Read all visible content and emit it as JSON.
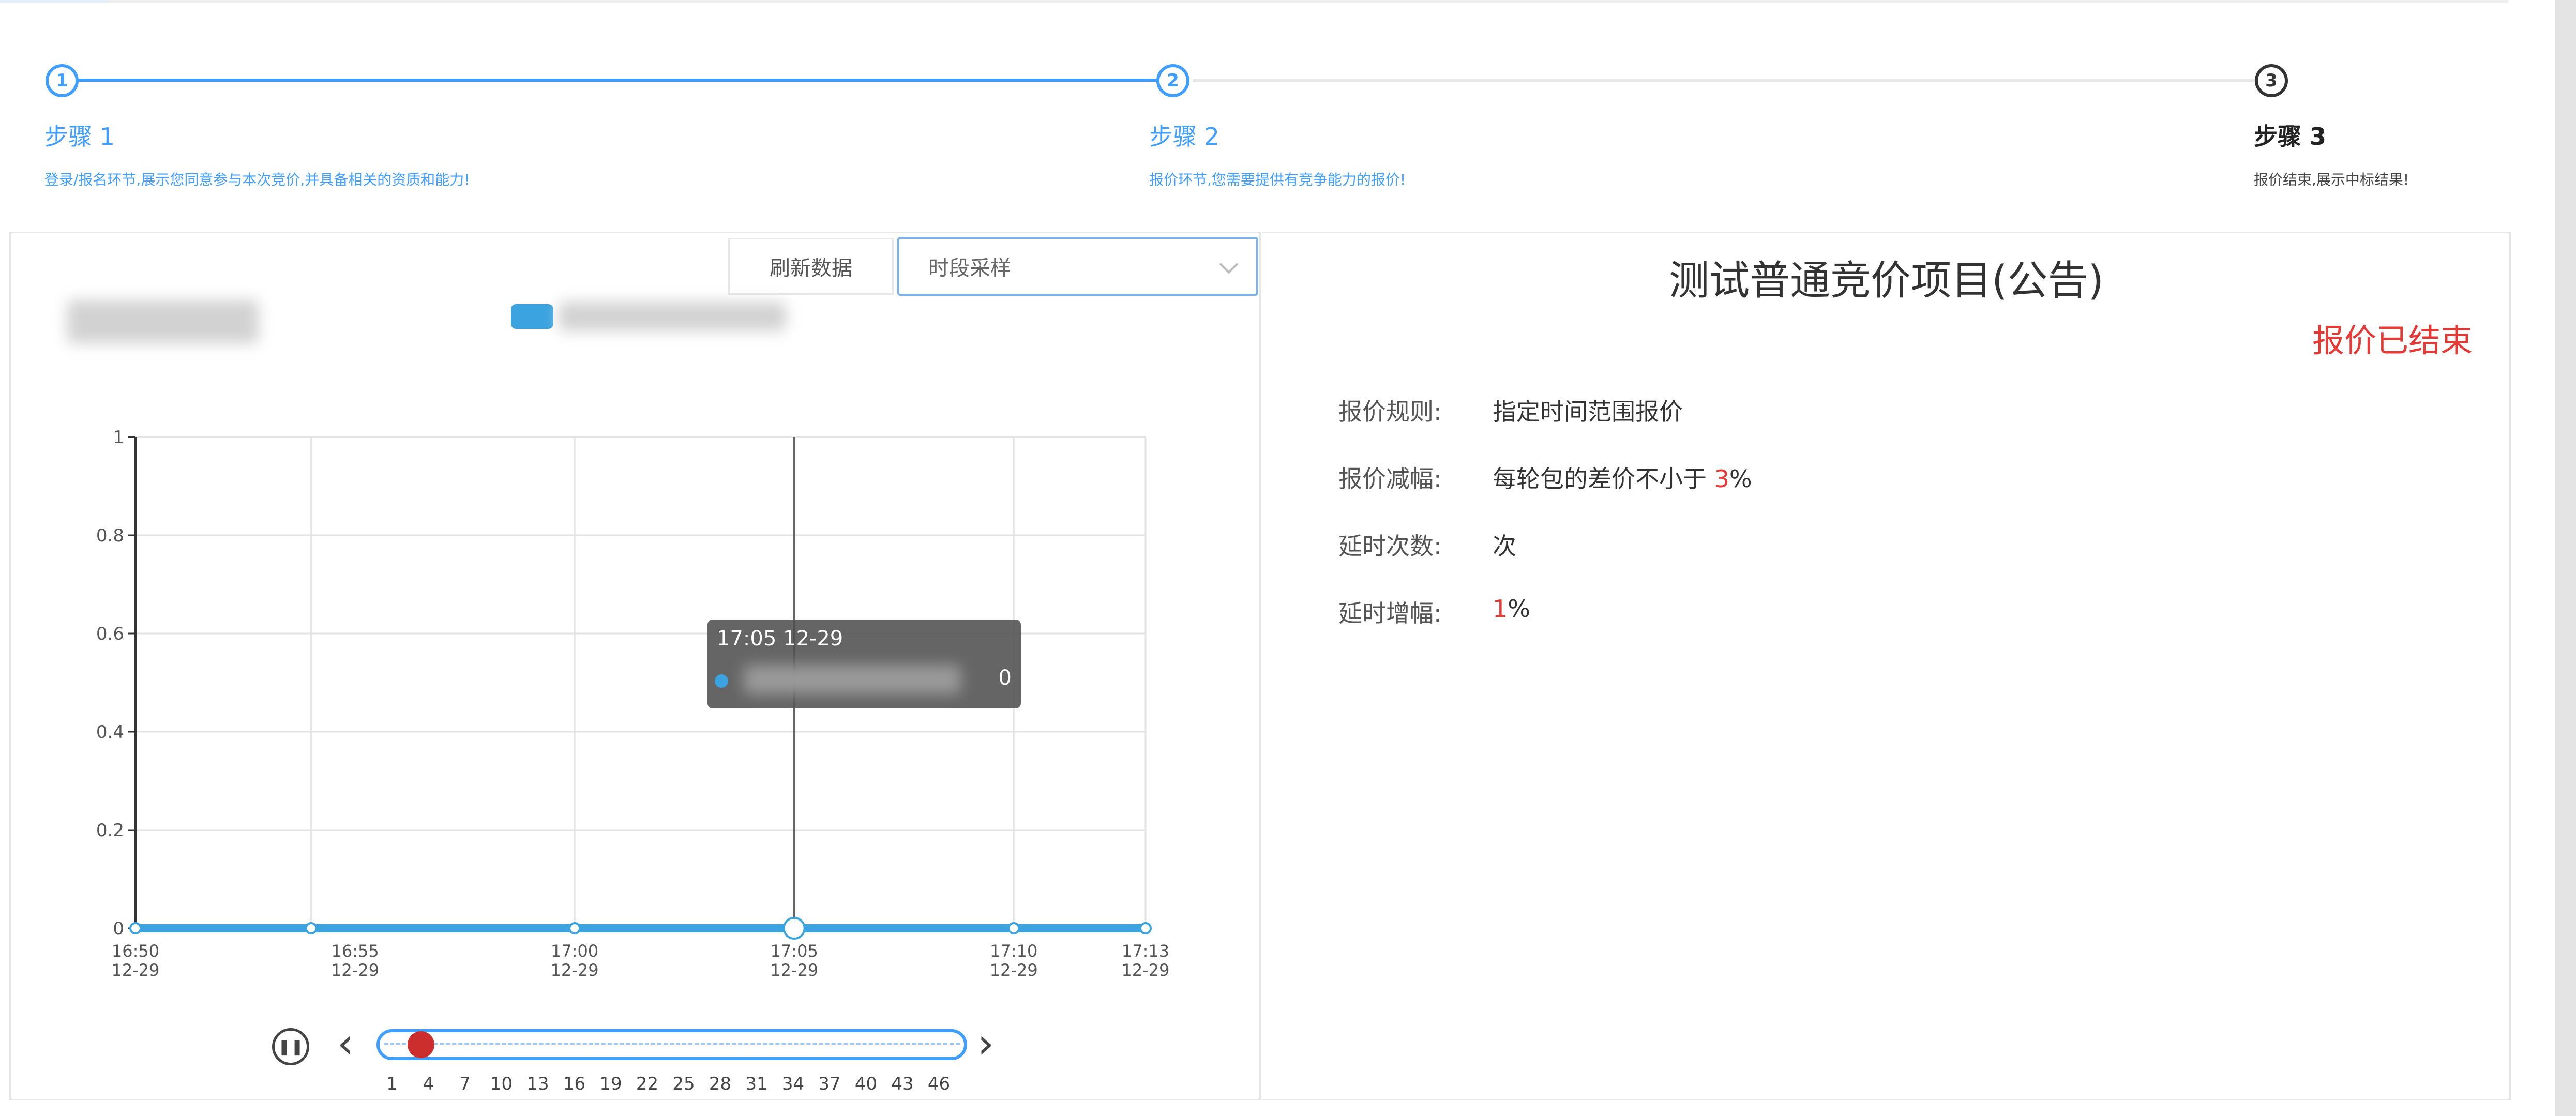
{
  "colors": {
    "accent": "#409eff",
    "alert": "#e53935",
    "series": "#3aa3e0",
    "slider_thumb": "#cc2d2d"
  },
  "steps": [
    {
      "number": "1",
      "title": "步骤 1",
      "desc": "登录/报名环节,展示您同意参与本次竞价,并具备相关的资质和能力!"
    },
    {
      "number": "2",
      "title": "步骤 2",
      "desc": "报价环节,您需要提供有竞争能力的报价!"
    },
    {
      "number": "3",
      "title": "步骤 3",
      "desc": "报价结束,展示中标结果!"
    }
  ],
  "toolbar": {
    "refresh_label": "刷新数据",
    "select_value": "时段采样"
  },
  "chart_data": {
    "type": "line",
    "x": [
      "16:50 12-29",
      "16:55 12-29",
      "17:00 12-29",
      "17:05 12-29",
      "17:10 12-29",
      "17:13 12-29"
    ],
    "point_x_minutes": [
      0,
      4,
      10,
      15,
      20,
      23
    ],
    "series": [
      {
        "values": [
          0,
          0,
          0,
          0,
          0,
          0
        ]
      }
    ],
    "ylim": [
      0,
      1
    ],
    "yticks": [
      "0",
      "0.2",
      "0.4",
      "0.6",
      "0.8",
      "1"
    ],
    "grid": true,
    "tooltip": {
      "title": "17:05 12-29",
      "value": "0"
    },
    "timeline": {
      "play_icon": "pause-icon",
      "ticks": [
        "1",
        "4",
        "7",
        "10",
        "13",
        "16",
        "19",
        "22",
        "25",
        "28",
        "31",
        "34",
        "37",
        "40",
        "43",
        "46"
      ],
      "current": 3
    }
  },
  "project": {
    "title": "测试普通竞价项目(公告)",
    "status": "报价已结束",
    "rules_label": "报价规则:",
    "rules_value": "指定时间范围报价",
    "decrease_label": "报价减幅:",
    "decrease_prefix": "每轮包的差价不小于",
    "decrease_num": "3",
    "decrease_unit": "%",
    "delay_count_label": "延时次数:",
    "delay_count_value": "次",
    "delay_increase_label": "延时增幅:",
    "delay_increase_num": "1",
    "delay_increase_unit": "%"
  }
}
